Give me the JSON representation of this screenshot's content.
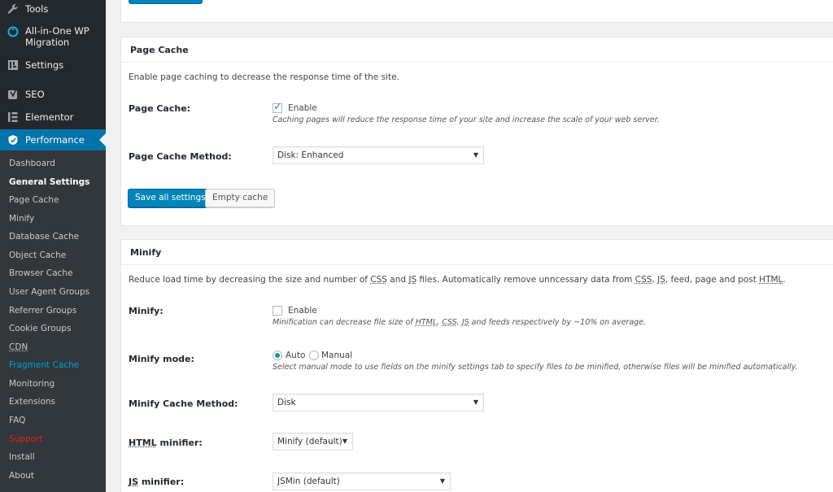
{
  "sidebar": {
    "menu": [
      {
        "label": "Tools",
        "icon": "wrench-icon"
      },
      {
        "label": "All-in-One WP Migration",
        "line1": "All-in-One WP",
        "line2": "Migration",
        "icon": "migration-icon"
      },
      {
        "label": "Settings",
        "icon": "settings-icon"
      },
      {
        "label": "SEO",
        "icon": "yoast-seo-icon"
      },
      {
        "label": "Elementor",
        "icon": "elementor-icon"
      },
      {
        "label": "Performance",
        "icon": "performance-icon",
        "active": true
      }
    ],
    "submenu": [
      "Dashboard",
      "General Settings",
      "Page Cache",
      "Minify",
      "Database Cache",
      "Object Cache",
      "Browser Cache",
      "User Agent Groups",
      "Referrer Groups",
      "Cookie Groups",
      "CDN",
      "Fragment Cache",
      "Monitoring",
      "Extensions",
      "FAQ",
      "Support",
      "Install",
      "About"
    ],
    "current_submenu": "General Settings",
    "colors": {
      "sidebar_bg": "#23282d",
      "submenu_bg": "#32373c",
      "active_bg": "#0073aa",
      "fragment_cache": "#00a0d2",
      "support": "#e02020"
    }
  },
  "page_cache": {
    "title": "Page Cache",
    "description": "Enable page caching to decrease the response time of the site.",
    "enable_label": "Page Cache:",
    "enable_checkbox": "Enable",
    "enable_checked": true,
    "enable_hint": "Caching pages will reduce the response time of your site and increase the scale of your web server.",
    "method_label": "Page Cache Method:",
    "method_value": "Disk: Enhanced",
    "save_button": "Save all settings",
    "empty_button": "Empty cache"
  },
  "minify": {
    "title": "Minify",
    "description": {
      "p1": "Reduce load time by decreasing the size and number of ",
      "css": "CSS",
      "p2": " and ",
      "js": "JS",
      "p3": " files. Automatically remove unncessary data from ",
      "css2": "CSS",
      "p4": ", ",
      "js2": "JS",
      "p5": ", feed, page and post ",
      "html": "HTML",
      "p6": "."
    },
    "enable_label": "Minify:",
    "enable_checkbox": "Enable",
    "enable_checked": false,
    "enable_hint": {
      "p1": "Minification can decrease file size of ",
      "html": "HTML",
      "p2": ", ",
      "css": "CSS",
      "p3": ", ",
      "js": "JS",
      "p4": " and feeds respectively by ~10% on average."
    },
    "mode_label": "Minify mode:",
    "mode_auto": "Auto",
    "mode_manual": "Manual",
    "mode_selected": "Auto",
    "mode_hint": "Select manual mode to use fields on the minify settings tab to specify files to be minified, otherwise files will be minified automatically.",
    "cache_method_label": "Minify Cache Method:",
    "cache_method_value": "Disk",
    "html_minifier_abbr": "HTML",
    "html_minifier_rest": " minifier:",
    "html_minifier_value": "Minify (default)",
    "js_minifier_abbr": "JS",
    "js_minifier_rest": " minifier:",
    "js_minifier_value": "JSMin (default)"
  }
}
